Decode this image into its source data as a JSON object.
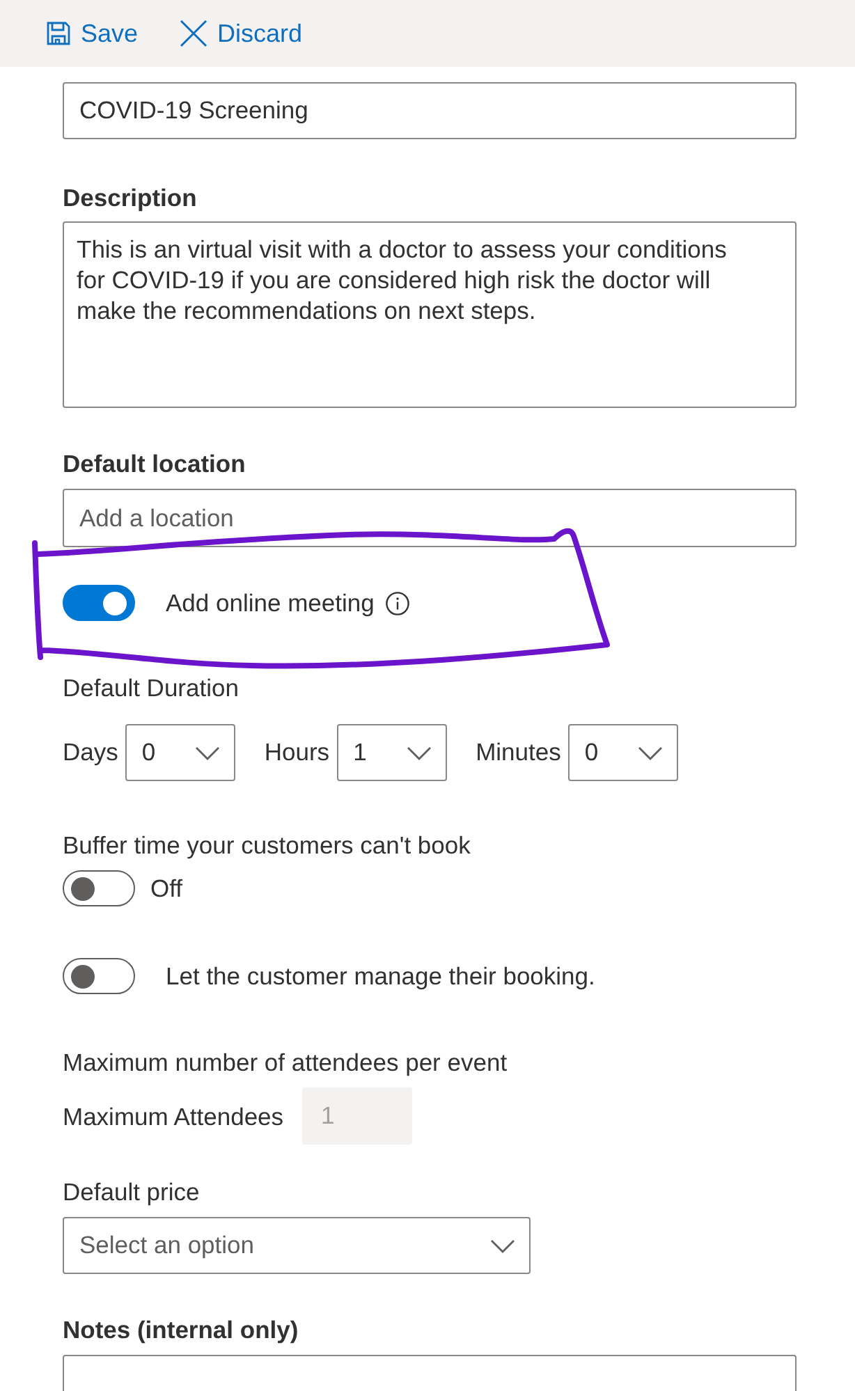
{
  "toolbar": {
    "buttons": [
      {
        "kind": "save",
        "label": "Save"
      },
      {
        "kind": "discard",
        "label": "Discard"
      }
    ]
  },
  "service_name": {
    "value": "COVID-19 Screening"
  },
  "description": {
    "label": "Description",
    "value": "This is an virtual visit with a doctor to assess your conditions for COVID-19 if you are considered high risk the doctor will make the recommendations on next steps."
  },
  "default_location": {
    "label": "Default location",
    "placeholder": "Add a location"
  },
  "online_meeting": {
    "label": "Add online meeting",
    "on": true,
    "highlighted": true
  },
  "default_duration": {
    "label": "Default Duration",
    "fields": [
      {
        "label": "Days",
        "value": "0"
      },
      {
        "label": "Hours",
        "value": "1"
      },
      {
        "label": "Minutes",
        "value": "0"
      }
    ]
  },
  "buffer_time": {
    "label": "Buffer time your customers can't book",
    "on": false,
    "state_text": "Off"
  },
  "customer_manage": {
    "label": "Let the customer manage their booking.",
    "on": false
  },
  "max_attendees": {
    "heading": "Maximum number of attendees per event",
    "label": "Maximum Attendees",
    "value": "1",
    "disabled": true
  },
  "default_price": {
    "label": "Default price",
    "placeholder": "Select an option"
  },
  "notes": {
    "label": "Notes (internal only)"
  }
}
